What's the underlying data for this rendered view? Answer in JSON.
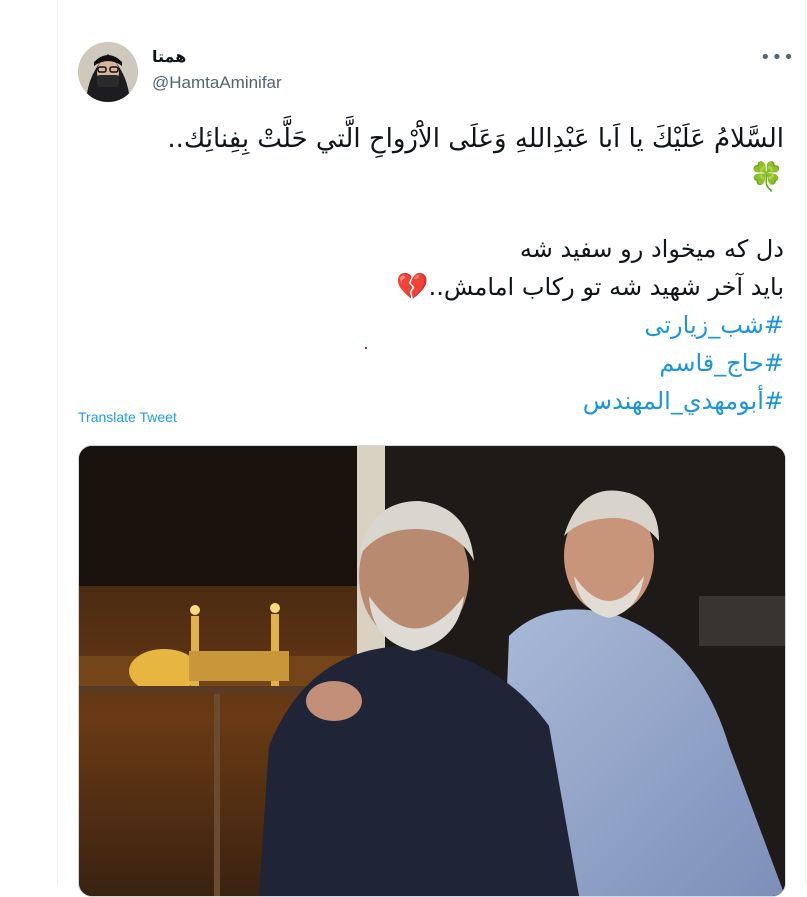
{
  "user": {
    "display_name": "همتا",
    "handle": "@HamtaAminifar",
    "avatar": "avatar-photo"
  },
  "menu": {
    "more_label": "•••",
    "icon": "more-horizontal-icon"
  },
  "tweet": {
    "line1": "السَّلامُ عَلَيْكَ يا اَبا عَبْدِاللهِ وَعَلَی الاَْرْواحِ الَّتي حَلَّتْ بِفِنائِك..",
    "clover": "🍀",
    "line3": "دل که میخواد رو سفید شه",
    "line4": "باید آخر شهید شه تو رکاب امامش..",
    "broken_heart": "💔",
    "hashtags": [
      "#شب_زیارتی",
      "#حاج_قاسم",
      "#أبومهدي_المهندس"
    ]
  },
  "translate_label": "Translate Tweet",
  "media": {
    "icon": "photo-two-men-shrine-night"
  },
  "colors": {
    "link": "#1d9bf0",
    "hashtag": "#1b95e0",
    "text": "#0f1419",
    "muted": "#536471"
  }
}
